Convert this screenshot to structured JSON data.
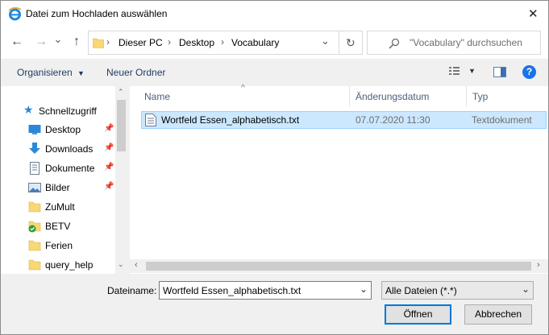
{
  "window": {
    "title": "Datei zum Hochladen auswählen",
    "close_glyph": "✕"
  },
  "nav": {
    "back_glyph": "←",
    "forward_glyph": "→",
    "recent_glyph": "⌄",
    "up_glyph": "↑",
    "refresh_glyph": "↻"
  },
  "address": {
    "crumbs": [
      "Dieser PC",
      "Desktop",
      "Vocabulary"
    ],
    "separator": "›",
    "dropdown_glyph": "⌄"
  },
  "search": {
    "placeholder": "\"Vocabulary\" durchsuchen"
  },
  "toolbar": {
    "organize_label": "Organisieren",
    "new_folder_label": "Neuer Ordner",
    "help_glyph": "?"
  },
  "sidebar": {
    "quick_access_label": "Schnellzugriff",
    "items": [
      {
        "label": "Desktop",
        "pinned": true,
        "icon": "desktop-icon"
      },
      {
        "label": "Downloads",
        "pinned": true,
        "icon": "download-icon"
      },
      {
        "label": "Dokumente",
        "pinned": true,
        "icon": "document-icon"
      },
      {
        "label": "Bilder",
        "pinned": true,
        "icon": "pictures-icon"
      },
      {
        "label": "ZuMult",
        "pinned": false,
        "icon": "folder-icon"
      },
      {
        "label": "BETV",
        "pinned": false,
        "icon": "folder-synced-icon"
      },
      {
        "label": "Ferien",
        "pinned": false,
        "icon": "folder-icon"
      },
      {
        "label": "query_help",
        "pinned": false,
        "icon": "folder-icon"
      }
    ]
  },
  "file_list": {
    "columns": [
      "Name",
      "Änderungsdatum",
      "Typ"
    ],
    "sort_glyph": "^",
    "rows": [
      {
        "name": "Wortfeld Essen_alphabetisch.txt",
        "date": "07.07.2020 11:30",
        "type": "Textdokument",
        "selected": true
      }
    ]
  },
  "footer": {
    "filename_label": "Dateiname:",
    "filename_value": "Wortfeld Essen_alphabetisch.txt",
    "filter_value": "Alle Dateien (*.*)",
    "open_label": "Öffnen",
    "cancel_label": "Abbrechen"
  },
  "colors": {
    "accent": "#0078d7",
    "selection": "#cce8ff",
    "help": "#1a73e8"
  }
}
